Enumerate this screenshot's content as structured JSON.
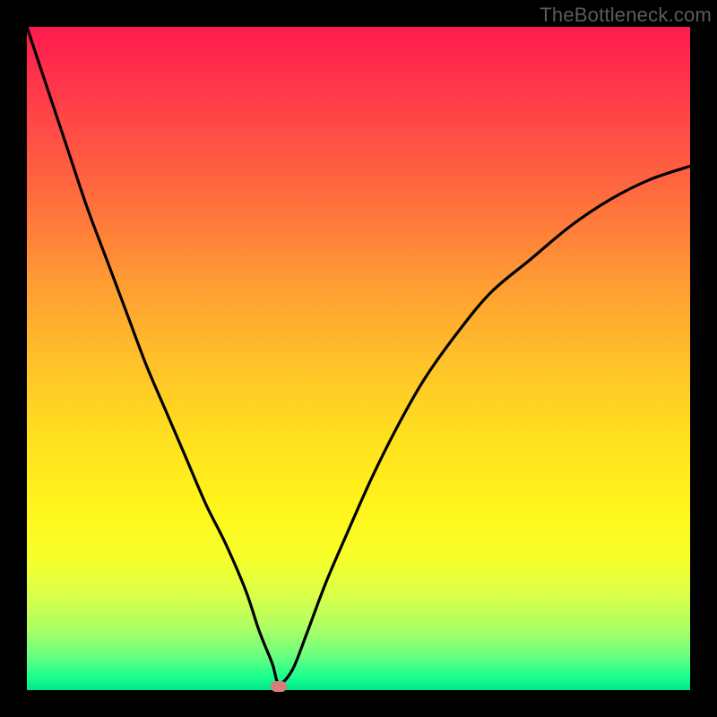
{
  "watermark": "TheBottleneck.com",
  "colors": {
    "curve": "#000000",
    "marker": "#d97c7c"
  },
  "chart_data": {
    "type": "line",
    "title": "",
    "xlabel": "",
    "ylabel": "",
    "xlim": [
      0,
      100
    ],
    "ylim": [
      0,
      100
    ],
    "grid": false,
    "legend": false,
    "note": "Bottleneck-style curve: steep descent from top-left to a minimum near x≈38, then rising to the right. Values estimated from pixel positions; no axis ticks present.",
    "series": [
      {
        "name": "bottleneck-curve",
        "x": [
          0,
          3,
          6,
          9,
          12,
          15,
          18,
          21,
          24,
          27,
          30,
          33,
          35,
          37,
          38,
          40,
          42,
          45,
          48,
          52,
          56,
          60,
          65,
          70,
          76,
          82,
          88,
          94,
          100
        ],
        "y": [
          100,
          91,
          82,
          73,
          65,
          57,
          49,
          42,
          35,
          28,
          22,
          15,
          9,
          4,
          1,
          3,
          8,
          16,
          23,
          32,
          40,
          47,
          54,
          60,
          65,
          70,
          74,
          77,
          79
        ]
      }
    ],
    "min_marker": {
      "x": 38,
      "y": 0.5
    }
  }
}
